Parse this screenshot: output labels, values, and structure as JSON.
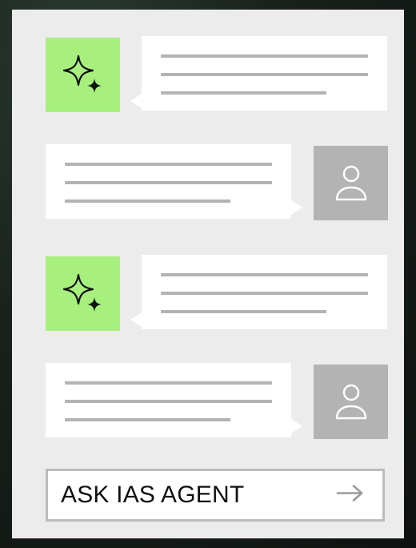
{
  "chat": {
    "messages": [
      {
        "sender": "agent",
        "avatar_icon": "sparkle-icon"
      },
      {
        "sender": "user",
        "avatar_icon": "user-icon"
      },
      {
        "sender": "agent",
        "avatar_icon": "sparkle-icon"
      },
      {
        "sender": "user",
        "avatar_icon": "user-icon"
      }
    ]
  },
  "ask": {
    "label": "ASK IAS AGENT",
    "icon": "arrow-right-icon"
  },
  "colors": {
    "agent_avatar": "#a8f07e",
    "user_avatar": "#b3b3b3",
    "panel": "#ececec",
    "bubble": "#ffffff",
    "placeholder_line": "#b3b3b3"
  }
}
